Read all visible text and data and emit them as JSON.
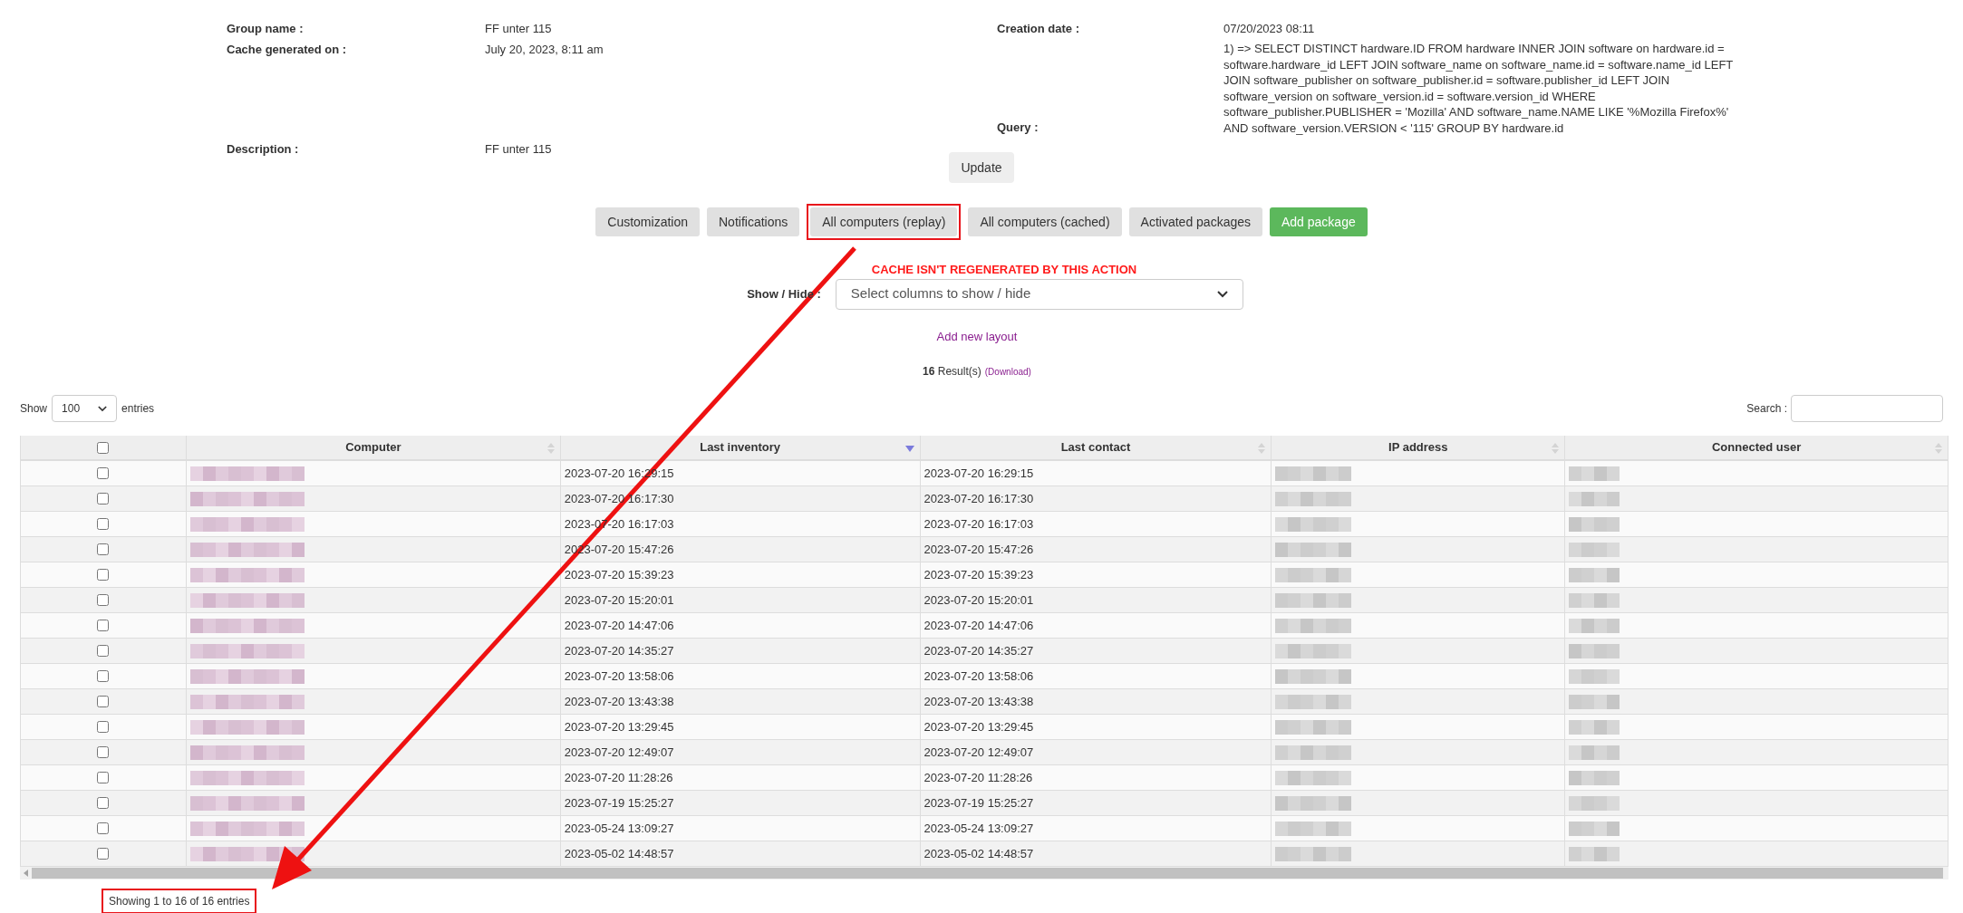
{
  "group_info": {
    "left": [
      {
        "label": "Group name :",
        "value": "FF unter 115"
      },
      {
        "label": "Cache generated on :",
        "value": "July 20, 2023, 8:11 am"
      },
      {
        "label": "Description :",
        "value": "FF unter 115"
      }
    ],
    "right": [
      {
        "label": "Creation date :",
        "value": "07/20/2023 08:11"
      },
      {
        "label": "Query :",
        "value": "1) => SELECT DISTINCT hardware.ID FROM hardware INNER JOIN software on hardware.id = software.hardware_id LEFT JOIN software_name on software_name.id = software.name_id LEFT JOIN software_publisher on software_publisher.id = software.publisher_id LEFT JOIN software_version on software_version.id = software.version_id WHERE software_publisher.PUBLISHER = 'Mozilla' AND software_name.NAME LIKE '%Mozilla Firefox%' AND software_version.VERSION < '115' GROUP BY hardware.id"
      }
    ]
  },
  "update_button": "Update",
  "tabs": [
    {
      "label": "Customization",
      "kind": "tab",
      "annotated": false
    },
    {
      "label": "Notifications",
      "kind": "tab",
      "annotated": false
    },
    {
      "label": "All computers (replay)",
      "kind": "tab",
      "annotated": true
    },
    {
      "label": "All computers (cached)",
      "kind": "tab",
      "annotated": false
    },
    {
      "label": "Activated packages",
      "kind": "tab",
      "annotated": false
    },
    {
      "label": "Add package",
      "kind": "action",
      "annotated": false
    }
  ],
  "warning": "CACHE ISN'T REGENERATED BY THIS ACTION",
  "show_hide": {
    "label": "Show / Hide :",
    "placeholder": "Select columns to show / hide"
  },
  "add_layout_link": "Add new layout",
  "results": {
    "count": "16",
    "label": "Result(s)",
    "download": "(Download)"
  },
  "length_menu": {
    "before": "Show",
    "value": "100",
    "after": "entries"
  },
  "search": {
    "label": "Search :"
  },
  "table": {
    "columns": [
      {
        "kind": "checkbox",
        "checked": false
      },
      {
        "label": "Computer",
        "kind": "redacted",
        "sorted_desc": false
      },
      {
        "label": "Last inventory",
        "kind": "text",
        "sorted_desc": true
      },
      {
        "label": "Last contact",
        "kind": "text",
        "sorted_desc": false
      },
      {
        "label": "IP address",
        "kind": "redacted",
        "sorted_desc": false
      },
      {
        "label": "Connected user",
        "kind": "redacted",
        "sorted_desc": false
      }
    ],
    "rows": [
      {
        "checked": false,
        "last_inventory": "2023-07-20 16:29:15",
        "last_contact": "2023-07-20 16:29:15"
      },
      {
        "checked": false,
        "last_inventory": "2023-07-20 16:17:30",
        "last_contact": "2023-07-20 16:17:30"
      },
      {
        "checked": false,
        "last_inventory": "2023-07-20 16:17:03",
        "last_contact": "2023-07-20 16:17:03"
      },
      {
        "checked": false,
        "last_inventory": "2023-07-20 15:47:26",
        "last_contact": "2023-07-20 15:47:26"
      },
      {
        "checked": false,
        "last_inventory": "2023-07-20 15:39:23",
        "last_contact": "2023-07-20 15:39:23"
      },
      {
        "checked": false,
        "last_inventory": "2023-07-20 15:20:01",
        "last_contact": "2023-07-20 15:20:01"
      },
      {
        "checked": false,
        "last_inventory": "2023-07-20 14:47:06",
        "last_contact": "2023-07-20 14:47:06"
      },
      {
        "checked": false,
        "last_inventory": "2023-07-20 14:35:27",
        "last_contact": "2023-07-20 14:35:27"
      },
      {
        "checked": false,
        "last_inventory": "2023-07-20 13:58:06",
        "last_contact": "2023-07-20 13:58:06"
      },
      {
        "checked": false,
        "last_inventory": "2023-07-20 13:43:38",
        "last_contact": "2023-07-20 13:43:38"
      },
      {
        "checked": false,
        "last_inventory": "2023-07-20 13:29:45",
        "last_contact": "2023-07-20 13:29:45"
      },
      {
        "checked": false,
        "last_inventory": "2023-07-20 12:49:07",
        "last_contact": "2023-07-20 12:49:07"
      },
      {
        "checked": false,
        "last_inventory": "2023-07-20 11:28:26",
        "last_contact": "2023-07-20 11:28:26"
      },
      {
        "checked": false,
        "last_inventory": "2023-07-19 15:25:27",
        "last_contact": "2023-07-19 15:25:27"
      },
      {
        "checked": false,
        "last_inventory": "2023-05-24 13:09:27",
        "last_contact": "2023-05-24 13:09:27"
      },
      {
        "checked": false,
        "last_inventory": "2023-05-02 14:48:57",
        "last_contact": "2023-05-02 14:48:57"
      }
    ]
  },
  "info": {
    "text": "Showing 1 to 16 of 16 entries",
    "annotated": true
  }
}
